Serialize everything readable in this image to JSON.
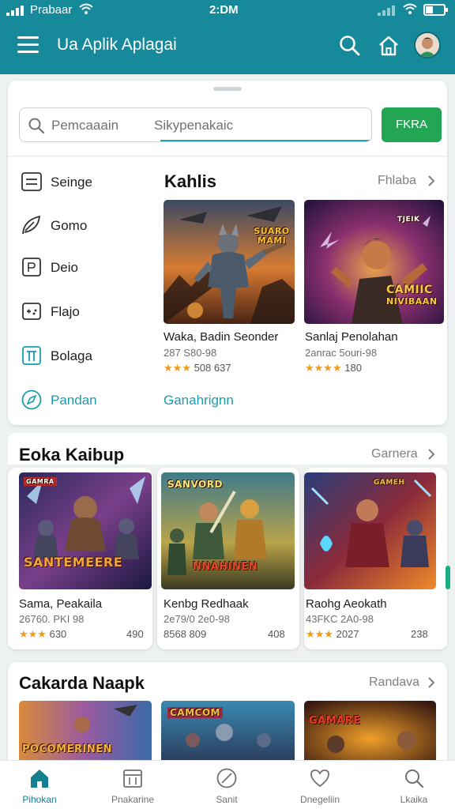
{
  "status": {
    "carrier": "Prabaar",
    "time": "2:DM"
  },
  "header": {
    "title": "Ua Aplik Aplagai"
  },
  "search": {
    "placeholder_left": "Pemcaaain",
    "placeholder_right": "Sikypenakaic",
    "button": "FKRA"
  },
  "categories": [
    {
      "label": "Seinge",
      "icon": "list-icon"
    },
    {
      "label": "Gomo",
      "icon": "leaf-icon"
    },
    {
      "label": "Deio",
      "icon": "puzzle-icon"
    },
    {
      "label": "Flajo",
      "icon": "gamepad-icon"
    },
    {
      "label": "Bolaga",
      "icon": "building-icon"
    },
    {
      "label": "Pandan",
      "icon": "compass-icon",
      "active": true
    }
  ],
  "featured": {
    "title": "Kahlis",
    "more": "Fhlaba",
    "see_all": "Ganahrignn",
    "games": [
      {
        "name": "Waka, Badin Seonder",
        "meta": "287 S80-98",
        "stars": "★★★",
        "rating": "508 637"
      },
      {
        "name": "Sanlaj Penolahan",
        "meta": "2anrac 5ouri-98",
        "stars": "★★★★",
        "rating": "180"
      }
    ]
  },
  "section2": {
    "title": "Eoka Kaibup",
    "more": "Garnera",
    "games": [
      {
        "name": "Sama, Peakaila",
        "meta": "26760. PKI 98",
        "stars": "★★★",
        "rating": "630",
        "count": "490"
      },
      {
        "name": "Kenbg Redhaak",
        "meta": "2e79/0 2e0-98",
        "stars": "",
        "rating": "8568 809",
        "count": "408"
      },
      {
        "name": "Raohg Aeokath",
        "meta": "43FKC 2A0-98",
        "stars": "★★★",
        "rating": "2027",
        "count": "238"
      }
    ]
  },
  "section3": {
    "title": "Cakarda Naapk",
    "more": "Randava"
  },
  "thumb_text": {
    "f1": "SUARO MAMI",
    "f2": [
      "CAMIIC",
      "NIVIBAAN"
    ],
    "f2_top": "TJEIK",
    "s1": "SANTEMEERE",
    "s1_top": "GAMRA",
    "s2_top": "SANVORD",
    "s2": "NNAHINEN",
    "s3_top": "GAMEH",
    "t1": "POCOMERINEN",
    "t2": "CAMCOM",
    "t3": "GAMARE"
  },
  "nav": [
    {
      "label": "Pihokan",
      "icon": "home-icon",
      "active": true
    },
    {
      "label": "Pnakarine",
      "icon": "calendar-icon"
    },
    {
      "label": "Sanit",
      "icon": "compass-icon"
    },
    {
      "label": "Dnegeliin",
      "icon": "heart-icon"
    },
    {
      "label": "Lkaika",
      "icon": "search-icon"
    }
  ]
}
